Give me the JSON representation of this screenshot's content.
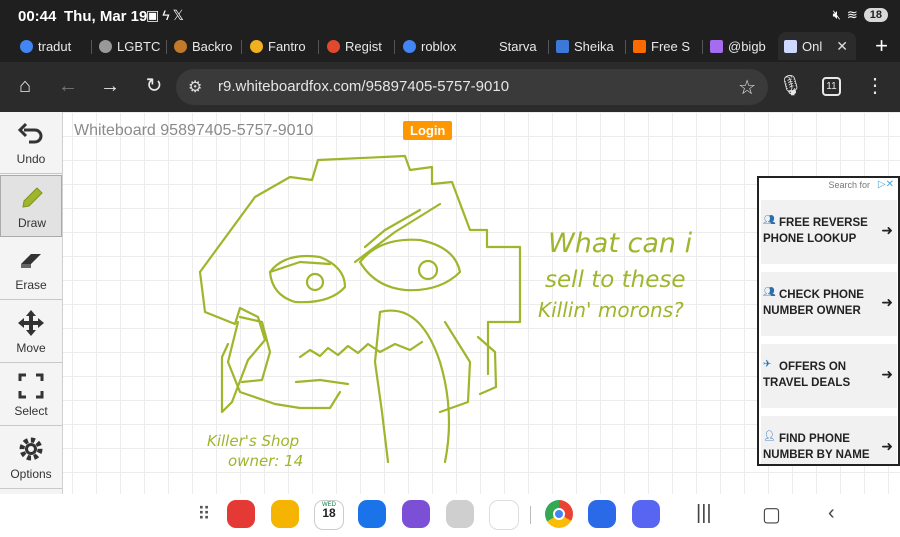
{
  "status_bar": {
    "time": "00:44",
    "date": "Thu, Mar 19",
    "battery": "18"
  },
  "tabs": [
    {
      "label": "tradut",
      "color": "#4285f4"
    },
    {
      "label": "LGBTC",
      "color": "#999999"
    },
    {
      "label": "Backro",
      "color": "#c17a2a"
    },
    {
      "label": "Fantro",
      "color": "#f2b01e"
    },
    {
      "label": "Regist",
      "color": "#e0482f"
    },
    {
      "label": "roblox",
      "color": "#4285f4"
    },
    {
      "label": "Starva",
      "color": "#444444"
    },
    {
      "label": "Sheika",
      "color": "#3c78d8"
    },
    {
      "label": "Free S",
      "color": "#ff6a00"
    },
    {
      "label": "@bigb",
      "color": "#a56cf0"
    },
    {
      "label": "Onl",
      "color": "#cfd8ff"
    }
  ],
  "browser": {
    "url": "r9.whiteboardfox.com/95897405-5757-9010",
    "tab_count": "11"
  },
  "whiteboard": {
    "title": "Whiteboard 95897405-5757-9010",
    "login_label": "Login",
    "tools": [
      {
        "label": "Undo",
        "icon": "undo-icon"
      },
      {
        "label": "Draw",
        "icon": "pencil-icon"
      },
      {
        "label": "Erase",
        "icon": "eraser-icon"
      },
      {
        "label": "Move",
        "icon": "move-icon"
      },
      {
        "label": "Select",
        "icon": "select-icon"
      },
      {
        "label": "Options",
        "icon": "gear-icon"
      }
    ],
    "drawing_text": {
      "line1": "What can i",
      "line2": "sell to these",
      "line3": "Killin' morons?",
      "sig1": "Killer's Shop",
      "sig2": "owner: 14"
    },
    "ink_color": "#9db62b"
  },
  "ad": {
    "search_for": "Search for",
    "items": [
      {
        "label": "FREE REVERSE PHONE LOOKUP",
        "icon": "people-icon"
      },
      {
        "label": "CHECK PHONE NUMBER OWNER",
        "icon": "people-icon"
      },
      {
        "label": "OFFERS ON TRAVEL DEALS",
        "icon": "plane-icon"
      },
      {
        "label": "FIND PHONE NUMBER BY NAME",
        "icon": "person-laptop-icon"
      }
    ]
  },
  "dock": {
    "calendar_day": "18",
    "calendar_weekday": "WED",
    "apps": [
      "app-drawer",
      "notes",
      "files",
      "calendar",
      "messages",
      "pen-up",
      "camera",
      "store",
      "chrome",
      "roblox",
      "discord"
    ]
  }
}
